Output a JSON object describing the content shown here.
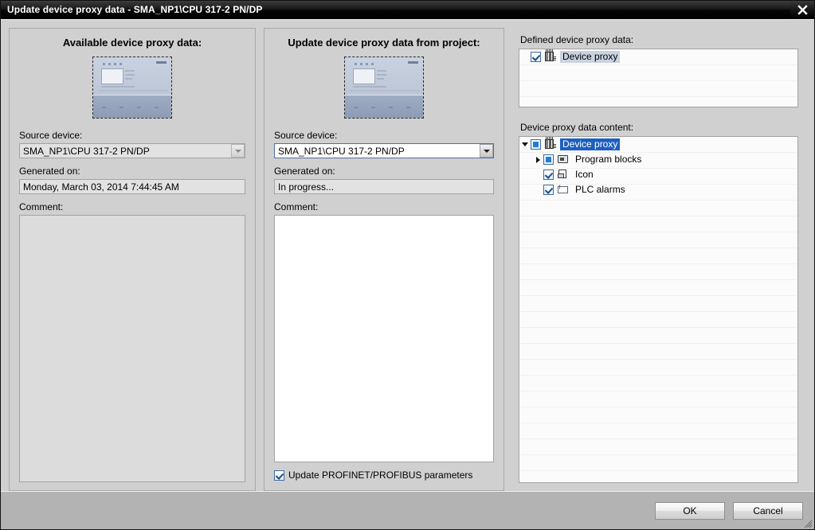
{
  "window": {
    "title": "Update device proxy data - SMA_NP1\\CPU 317-2 PN/DP",
    "close_icon": "close-icon"
  },
  "left_panel": {
    "title": "Available device proxy data:",
    "preview_alt": "device-proxy-preview",
    "source_device_label": "Source device:",
    "source_device_value": "SMA_NP1\\CPU 317-2 PN/DP",
    "generated_on_label": "Generated on:",
    "generated_on_value": "Monday, March 03, 2014 7:44:45 AM",
    "comment_label": "Comment:",
    "comment_value": ""
  },
  "middle_panel": {
    "title": "Update device proxy data from project:",
    "preview_alt": "device-proxy-preview",
    "source_device_label": "Source device:",
    "source_device_value": "SMA_NP1\\CPU 317-2 PN/DP",
    "generated_on_label": "Generated on:",
    "generated_on_value": "In progress...",
    "comment_label": "Comment:",
    "comment_value": "",
    "update_params_label": "Update PROFINET/PROFIBUS parameters",
    "update_params_checked": true
  },
  "right_panel": {
    "defined_label": "Defined device proxy data:",
    "defined_items": [
      {
        "label": "Device proxy",
        "check": "checked",
        "icon": "device-proxy-icon",
        "selected": "gray"
      }
    ],
    "content_label": "Device proxy data content:",
    "content_items": [
      {
        "label": "Device proxy",
        "check": "partial",
        "icon": "device-proxy-icon",
        "twist": "down",
        "indent": 0,
        "selected": "blue"
      },
      {
        "label": "Program blocks",
        "check": "partial",
        "icon": "program-blocks-icon",
        "twist": "right",
        "indent": 1,
        "selected": "none"
      },
      {
        "label": "Icon",
        "check": "checked",
        "icon": "icon-page-icon",
        "twist": "none",
        "indent": 1,
        "selected": "none"
      },
      {
        "label": "PLC alarms",
        "check": "checked",
        "icon": "plc-alarms-icon",
        "twist": "none",
        "indent": 1,
        "selected": "none"
      }
    ]
  },
  "footer": {
    "ok_label": "OK",
    "cancel_label": "Cancel"
  },
  "colors": {
    "titlebar": "#000000",
    "dialog_bg": "#d0d0d0",
    "footer_bg": "#b3b3b3",
    "selection_blue": "#1d5fbf",
    "selection_gray": "#c9d3e0",
    "field_active_border": "#4f6ea8"
  }
}
